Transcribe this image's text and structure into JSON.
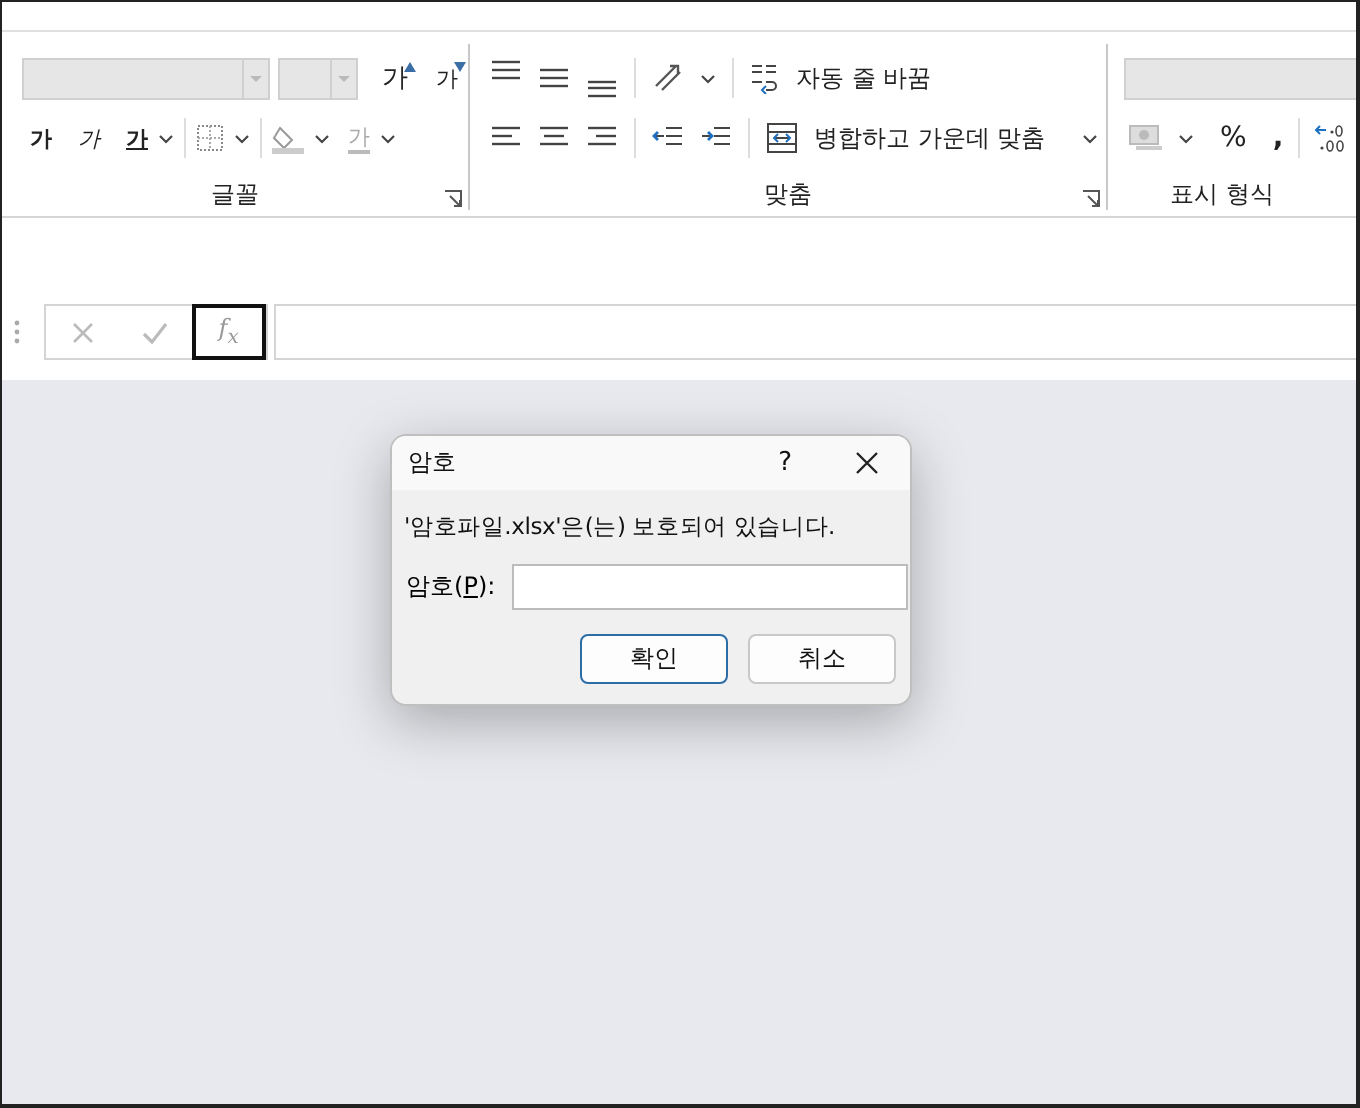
{
  "font_group": {
    "label": "글꼴",
    "grow_font": "가",
    "shrink_font": "가",
    "bold": "가",
    "italic": "가",
    "underline": "가",
    "font_color": "가"
  },
  "alignment_group": {
    "label": "맞춤",
    "wrap_text": "자동 줄 바꿈",
    "merge_center": "병합하고 가운데 맞춤"
  },
  "number_group": {
    "label": "표시 형식",
    "percent": "%",
    "comma": ","
  },
  "formula_bar": {
    "function_button": "f$_{x}$"
  },
  "dialog": {
    "title": "암호",
    "help": "?",
    "message": "'암호파일.xlsx'은(는) 보호되어 있습니다.",
    "password_label": {
      "before": "암호(",
      "access_key": "P",
      "after": "):"
    },
    "buttons": [
      {
        "label": "확인",
        "default": true
      },
      {
        "label": "취소",
        "default": false
      }
    ]
  }
}
